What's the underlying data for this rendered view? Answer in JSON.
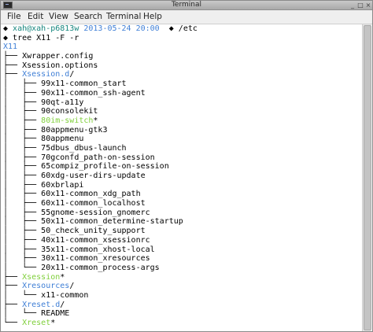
{
  "window": {
    "title": "Terminal",
    "controls": {
      "minimize": "_",
      "maximize": "□",
      "close": "×"
    }
  },
  "menu": [
    "File",
    "Edit",
    "View",
    "Search",
    "Terminal",
    "Help"
  ],
  "prompt": {
    "user_host": "xah@xah-p6813w",
    "datetime": "2013-05-24 20:00",
    "cwd": "/etc"
  },
  "command": "tree X11 -F -r",
  "tree": [
    {
      "prefix": "",
      "name": "X11",
      "suffix": "",
      "kind": "dir"
    },
    {
      "prefix": "├── ",
      "name": "Xwrapper.config",
      "suffix": "",
      "kind": "file"
    },
    {
      "prefix": "├── ",
      "name": "Xsession.options",
      "suffix": "",
      "kind": "file"
    },
    {
      "prefix": "├── ",
      "name": "Xsession.d",
      "suffix": "/",
      "kind": "dir"
    },
    {
      "prefix": "│   ├── ",
      "name": "99x11-common_start",
      "suffix": "",
      "kind": "file"
    },
    {
      "prefix": "│   ├── ",
      "name": "90x11-common_ssh-agent",
      "suffix": "",
      "kind": "file"
    },
    {
      "prefix": "│   ├── ",
      "name": "90qt-a11y",
      "suffix": "",
      "kind": "file"
    },
    {
      "prefix": "│   ├── ",
      "name": "90consolekit",
      "suffix": "",
      "kind": "file"
    },
    {
      "prefix": "│   ├── ",
      "name": "80im-switch",
      "suffix": "*",
      "kind": "exec"
    },
    {
      "prefix": "│   ├── ",
      "name": "80appmenu-gtk3",
      "suffix": "",
      "kind": "file"
    },
    {
      "prefix": "│   ├── ",
      "name": "80appmenu",
      "suffix": "",
      "kind": "file"
    },
    {
      "prefix": "│   ├── ",
      "name": "75dbus_dbus-launch",
      "suffix": "",
      "kind": "file"
    },
    {
      "prefix": "│   ├── ",
      "name": "70gconfd_path-on-session",
      "suffix": "",
      "kind": "file"
    },
    {
      "prefix": "│   ├── ",
      "name": "65compiz_profile-on-session",
      "suffix": "",
      "kind": "file"
    },
    {
      "prefix": "│   ├── ",
      "name": "60xdg-user-dirs-update",
      "suffix": "",
      "kind": "file"
    },
    {
      "prefix": "│   ├── ",
      "name": "60xbrlapi",
      "suffix": "",
      "kind": "file"
    },
    {
      "prefix": "│   ├── ",
      "name": "60x11-common_xdg_path",
      "suffix": "",
      "kind": "file"
    },
    {
      "prefix": "│   ├── ",
      "name": "60x11-common_localhost",
      "suffix": "",
      "kind": "file"
    },
    {
      "prefix": "│   ├── ",
      "name": "55gnome-session_gnomerc",
      "suffix": "",
      "kind": "file"
    },
    {
      "prefix": "│   ├── ",
      "name": "50x11-common_determine-startup",
      "suffix": "",
      "kind": "file"
    },
    {
      "prefix": "│   ├── ",
      "name": "50_check_unity_support",
      "suffix": "",
      "kind": "file"
    },
    {
      "prefix": "│   ├── ",
      "name": "40x11-common_xsessionrc",
      "suffix": "",
      "kind": "file"
    },
    {
      "prefix": "│   ├── ",
      "name": "35x11-common_xhost-local",
      "suffix": "",
      "kind": "file"
    },
    {
      "prefix": "│   ├── ",
      "name": "30x11-common_xresources",
      "suffix": "",
      "kind": "file"
    },
    {
      "prefix": "│   └── ",
      "name": "20x11-common_process-args",
      "suffix": "",
      "kind": "file"
    },
    {
      "prefix": "├── ",
      "name": "Xsession",
      "suffix": "*",
      "kind": "exec"
    },
    {
      "prefix": "├── ",
      "name": "Xresources",
      "suffix": "/",
      "kind": "dir"
    },
    {
      "prefix": "│   └── ",
      "name": "x11-common",
      "suffix": "",
      "kind": "file"
    },
    {
      "prefix": "├── ",
      "name": "Xreset.d",
      "suffix": "/",
      "kind": "dir"
    },
    {
      "prefix": "│   └── ",
      "name": "README",
      "suffix": "",
      "kind": "file"
    },
    {
      "prefix": "└── ",
      "name": "Xreset",
      "suffix": "*",
      "kind": "exec"
    }
  ],
  "colors": {
    "dir": "#3f7fd6",
    "exec": "#7fcf3a",
    "prompt_user": "#17867e",
    "prompt_date": "#3f7fd6"
  },
  "icons": [
    "terminal-icon",
    "minimize-icon",
    "maximize-icon",
    "close-icon"
  ]
}
